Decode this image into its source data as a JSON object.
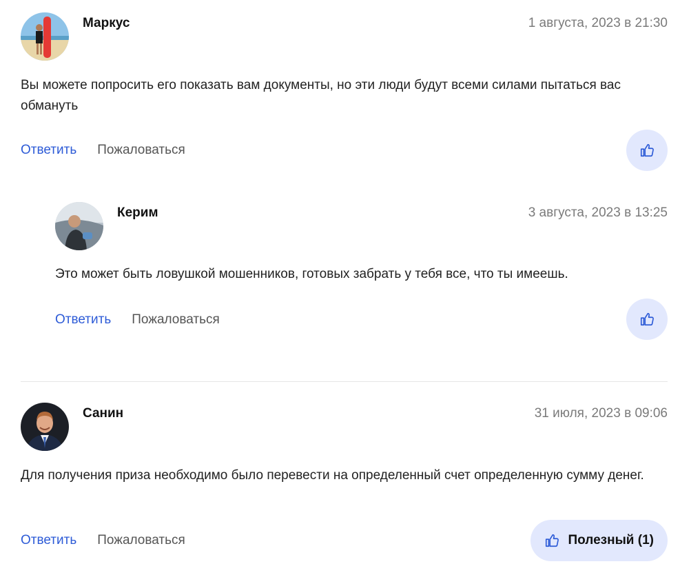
{
  "comments": [
    {
      "author": "Маркус",
      "date": "1 августа, 2023 в 21:30",
      "text": "Вы можете попросить его показать вам документы, но эти люди будут всеми силами пытаться вас обмануть",
      "reply_label": "Ответить",
      "report_label": "Пожаловаться",
      "like_icon": "thumbs-up-icon"
    },
    {
      "author": "Керим",
      "date": "3 августа, 2023 в 13:25",
      "text": "Это может быть ловушкой мошенников, готовых забрать у тебя все, что ты имеешь.",
      "reply_label": "Ответить",
      "report_label": "Пожаловаться",
      "like_icon": "thumbs-up-icon"
    },
    {
      "author": "Санин",
      "date": "31 июля, 2023 в 09:06",
      "text": "Для получения приза необходимо было перевести на определенный счет определенную сумму денег.",
      "reply_label": "Ответить",
      "report_label": "Пожаловаться",
      "useful_label": "Полезный (1)",
      "like_icon": "thumbs-up-icon"
    }
  ],
  "colors": {
    "link": "#2d5bd7",
    "like_bg": "#e2e8fd",
    "date": "#7a7a7a"
  }
}
